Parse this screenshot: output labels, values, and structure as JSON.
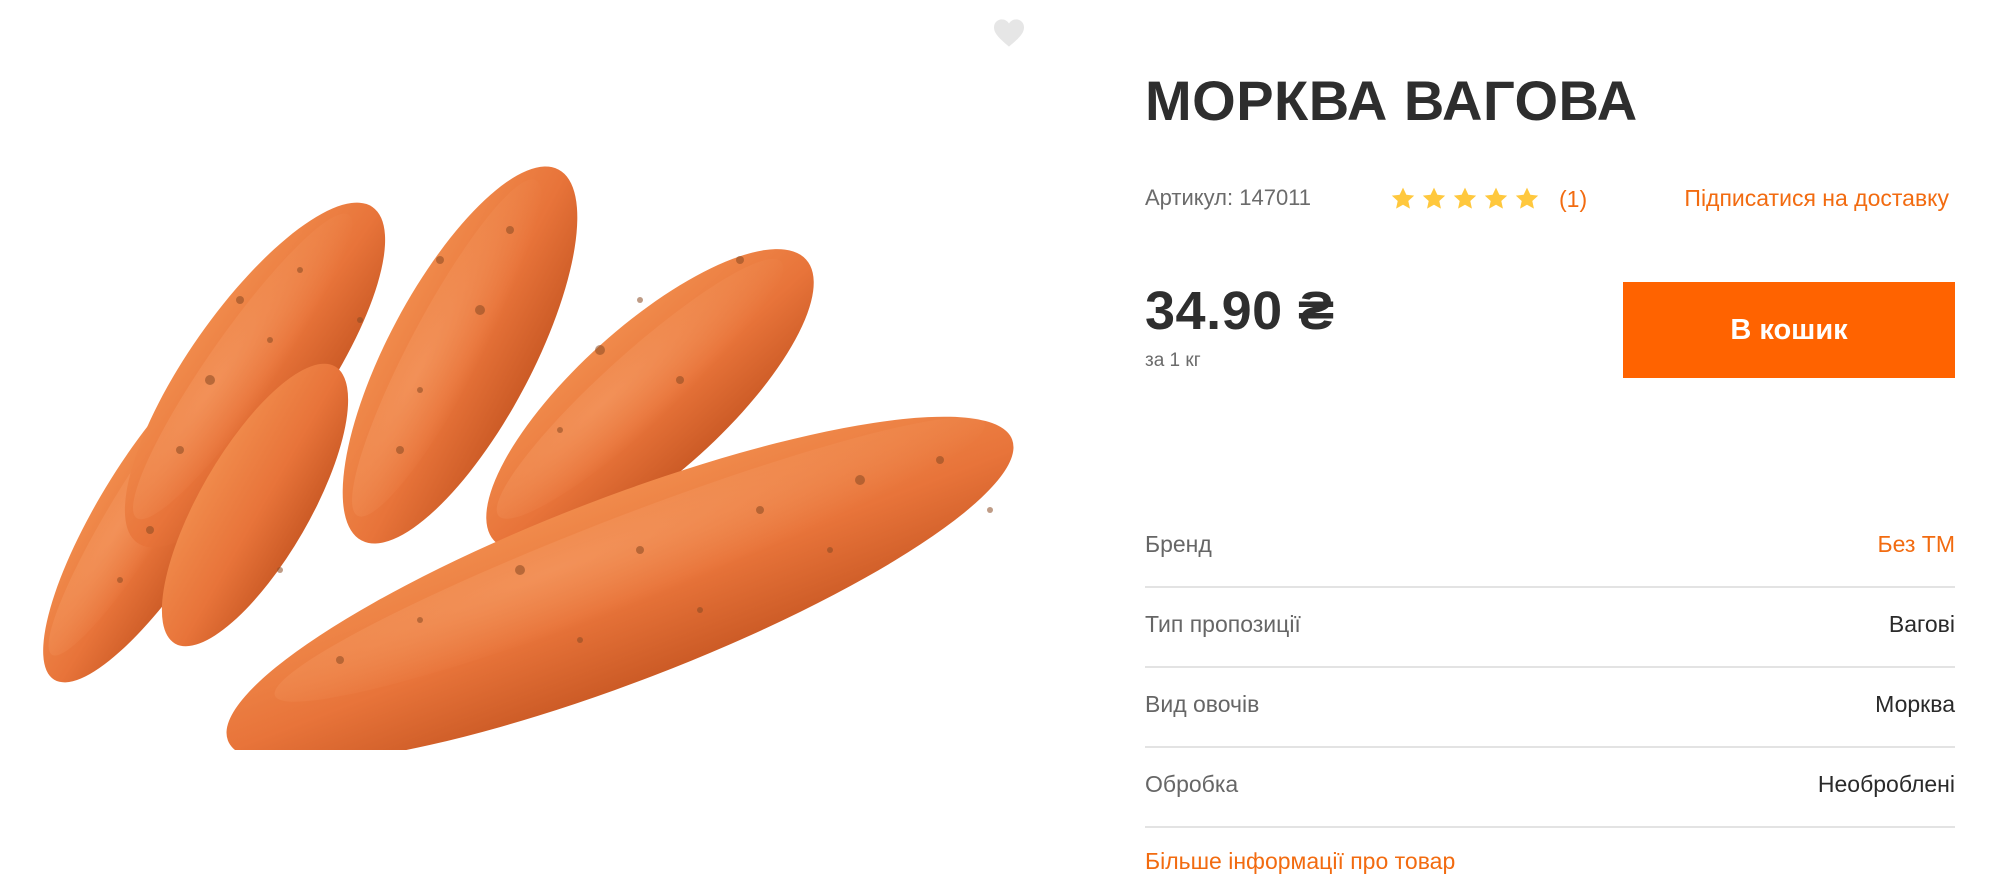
{
  "product": {
    "title": "МОРКВА ВАГОВА",
    "image_alt": "carrots-image",
    "favorite_icon": "heart-icon",
    "sku_text": "Артикул: 147011",
    "rating": {
      "stars": 5,
      "max": 5,
      "count_text": "(1)",
      "star_color": "#ffc83d"
    },
    "subscribe_label": "Підписатися на доставку",
    "price": "34.90 ₴",
    "unit": "за 1 кг",
    "cart_button": "В кошик",
    "more_info_link": "Більше інформації про товар"
  },
  "specs": [
    {
      "label": "Бренд",
      "value": "Без ТМ",
      "is_link": true
    },
    {
      "label": "Тип пропозиції",
      "value": "Вагові",
      "is_link": false
    },
    {
      "label": "Вид овочів",
      "value": "Морква",
      "is_link": false
    },
    {
      "label": "Обробка",
      "value": "Необроблені",
      "is_link": false
    }
  ],
  "colors": {
    "accent": "#ff6300",
    "link": "#f26b10",
    "text": "#2e2e2e",
    "muted": "#6b6b6b",
    "divider": "#e3e3e3"
  }
}
